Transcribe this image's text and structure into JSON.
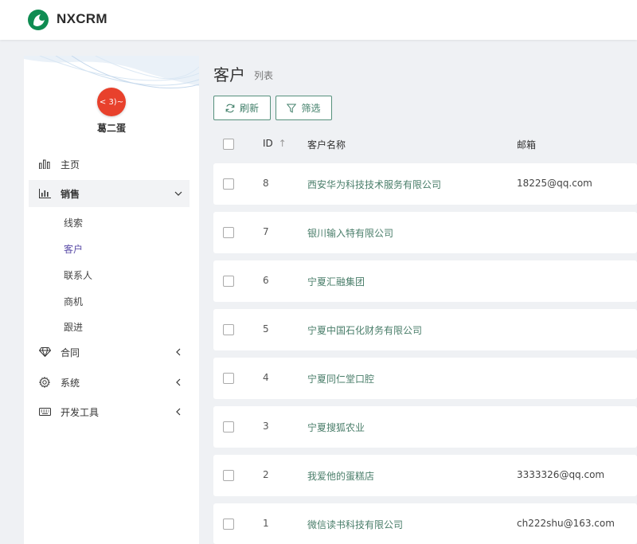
{
  "app": {
    "brand": "NXCRM",
    "brand_color": "#0f8c52"
  },
  "user": {
    "avatar_text": "< 3)~",
    "name": "葛二蛋"
  },
  "sidebar": {
    "items": [
      {
        "label": "主页",
        "icon": "bar-chart-icon"
      },
      {
        "label": "销售",
        "icon": "bar-chart-line-icon",
        "expanded": true
      },
      {
        "label": "合同",
        "icon": "diamond-icon"
      },
      {
        "label": "系统",
        "icon": "gear-icon"
      },
      {
        "label": "开发工具",
        "icon": "keyboard-icon"
      }
    ],
    "sales_submenu": [
      {
        "label": "线索"
      },
      {
        "label": "客户",
        "active": true
      },
      {
        "label": "联系人"
      },
      {
        "label": "商机"
      },
      {
        "label": "跟进"
      }
    ]
  },
  "page": {
    "title": "客户",
    "subtitle": "列表"
  },
  "toolbar": {
    "refresh_label": "刷新",
    "filter_label": "筛选"
  },
  "table": {
    "headers": {
      "id": "ID",
      "name": "客户名称",
      "email": "邮箱"
    },
    "sort_indicator": "↑",
    "rows": [
      {
        "id": "8",
        "name": "西安华为科技技术服务有限公司",
        "email": "18225@qq.com"
      },
      {
        "id": "7",
        "name": "银川输入特有限公司",
        "email": ""
      },
      {
        "id": "6",
        "name": "宁夏汇融集团",
        "email": ""
      },
      {
        "id": "5",
        "name": "宁夏中国石化财务有限公司",
        "email": ""
      },
      {
        "id": "4",
        "name": "宁夏同仁堂口腔",
        "email": ""
      },
      {
        "id": "3",
        "name": "宁夏搜狐农业",
        "email": ""
      },
      {
        "id": "2",
        "name": "我爱他的蛋糕店",
        "email": "3333326@qq.com"
      },
      {
        "id": "1",
        "name": "微信读书科技有限公司",
        "email": "ch222shu@163.com"
      }
    ]
  },
  "colors": {
    "accent": "#55907c",
    "link": "#4a7e6a",
    "active_submenu": "#5c4ea8",
    "avatar": "#e8412c"
  }
}
